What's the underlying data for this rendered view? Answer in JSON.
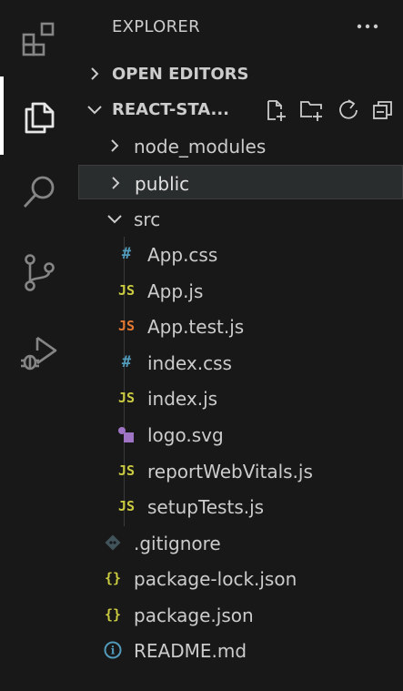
{
  "explorer": {
    "title": "EXPLORER",
    "more_label": "···"
  },
  "open_editors": {
    "label": "OPEN EDITORS"
  },
  "project": {
    "label": "REACT-STA..."
  },
  "tree": {
    "node_modules": "node_modules",
    "public": "public",
    "src": "src",
    "files": {
      "app_css": "App.css",
      "app_js": "App.js",
      "app_test_js": "App.test.js",
      "index_css": "index.css",
      "index_js": "index.js",
      "logo_svg": "logo.svg",
      "report_web_vitals": "reportWebVitals.js",
      "setup_tests": "setupTests.js"
    },
    "root_files": {
      "gitignore": ".gitignore",
      "package_lock": "package-lock.json",
      "package_json": "package.json",
      "readme": "README.md"
    }
  },
  "icons": {
    "css": "#",
    "js": "JS",
    "json": "{}",
    "info": "i"
  },
  "colors": {
    "css_icon": "#519aba",
    "js_icon": "#cbcb41",
    "test_icon": "#e37933",
    "json_icon": "#cbcb41",
    "svg_icon": "#a074c4",
    "git_icon": "#41535b",
    "info_icon": "#519aba"
  }
}
